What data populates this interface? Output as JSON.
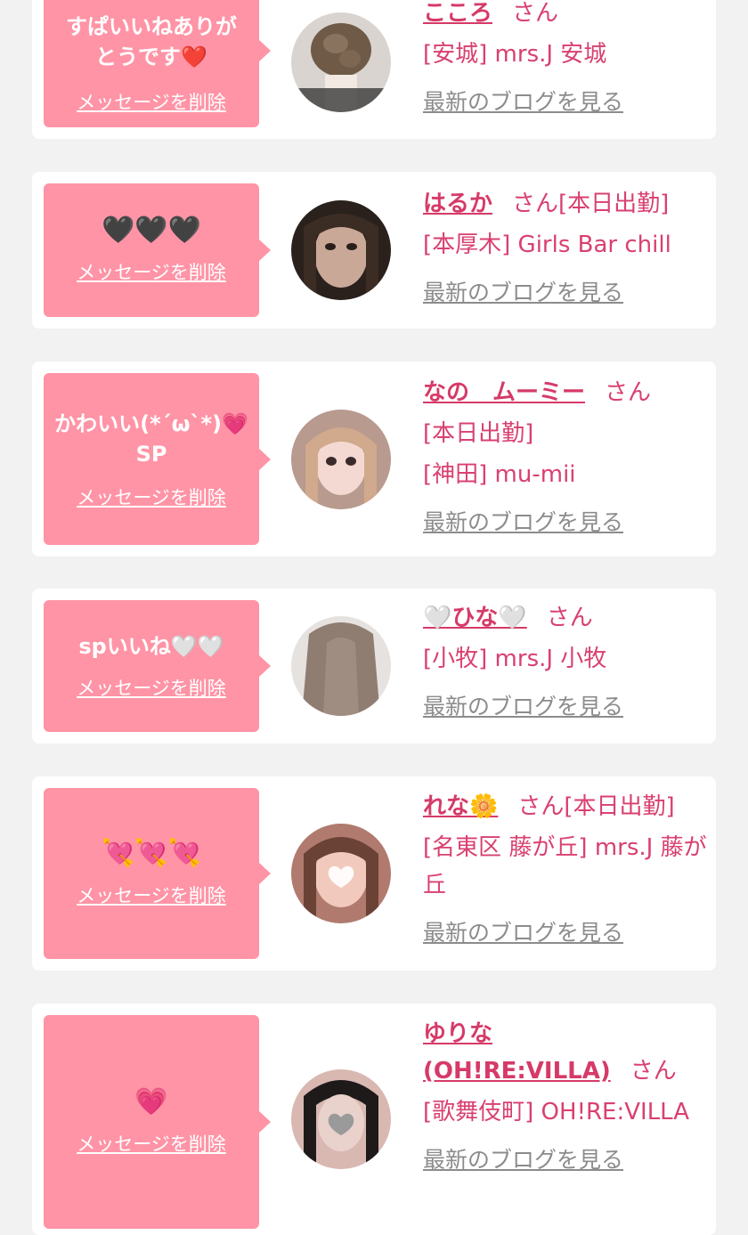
{
  "cards": [
    {
      "message": "すぱいいねありがとうです❤️",
      "delete_label": "メッセージを削除",
      "name": "こころ",
      "honorific": "さん",
      "status": "",
      "shop": "[安城] mrs.J 安城",
      "blog_label": "最新のブログを見る",
      "avatar_icon": "hair-photo"
    },
    {
      "message": "🖤🖤🖤",
      "delete_label": "メッセージを削除",
      "name": "はるか",
      "honorific": "さん",
      "status": "[本日出勤]",
      "shop": "[本厚木] Girls Bar chill",
      "blog_label": "最新のブログを見る",
      "avatar_icon": "portrait-photo"
    },
    {
      "message": "かわいい(*´ω`*)💗\nSP",
      "delete_label": "メッセージを削除",
      "name": "なの　ムーミー",
      "honorific": "さん",
      "status": "[本日出勤]",
      "shop": "[神田] mu-mii",
      "blog_label": "最新のブログを見る",
      "avatar_icon": "portrait-photo"
    },
    {
      "message": "spいいね🤍🤍",
      "delete_label": "メッセージを削除",
      "name": "🤍ひな🤍",
      "honorific": "さん",
      "status": "",
      "shop": "[小牧] mrs.J 小牧",
      "blog_label": "最新のブログを見る",
      "avatar_icon": "hair-photo"
    },
    {
      "message": "💘💘💘",
      "delete_label": "メッセージを削除",
      "name": "れな🌼",
      "honorific": "さん",
      "status": "[本日出勤]",
      "shop": "[名東区 藤が丘] mrs.J 藤が丘",
      "blog_label": "最新のブログを見る",
      "avatar_icon": "portrait-photo"
    },
    {
      "message": "💗",
      "delete_label": "メッセージを削除",
      "name": "ゆりな(OH!RE:VILLA)",
      "honorific": "さん",
      "status": "",
      "shop": "[歌舞伎町] OH!RE:VILLA",
      "blog_label": "最新のブログを見る",
      "avatar_icon": "portrait-photo"
    }
  ]
}
